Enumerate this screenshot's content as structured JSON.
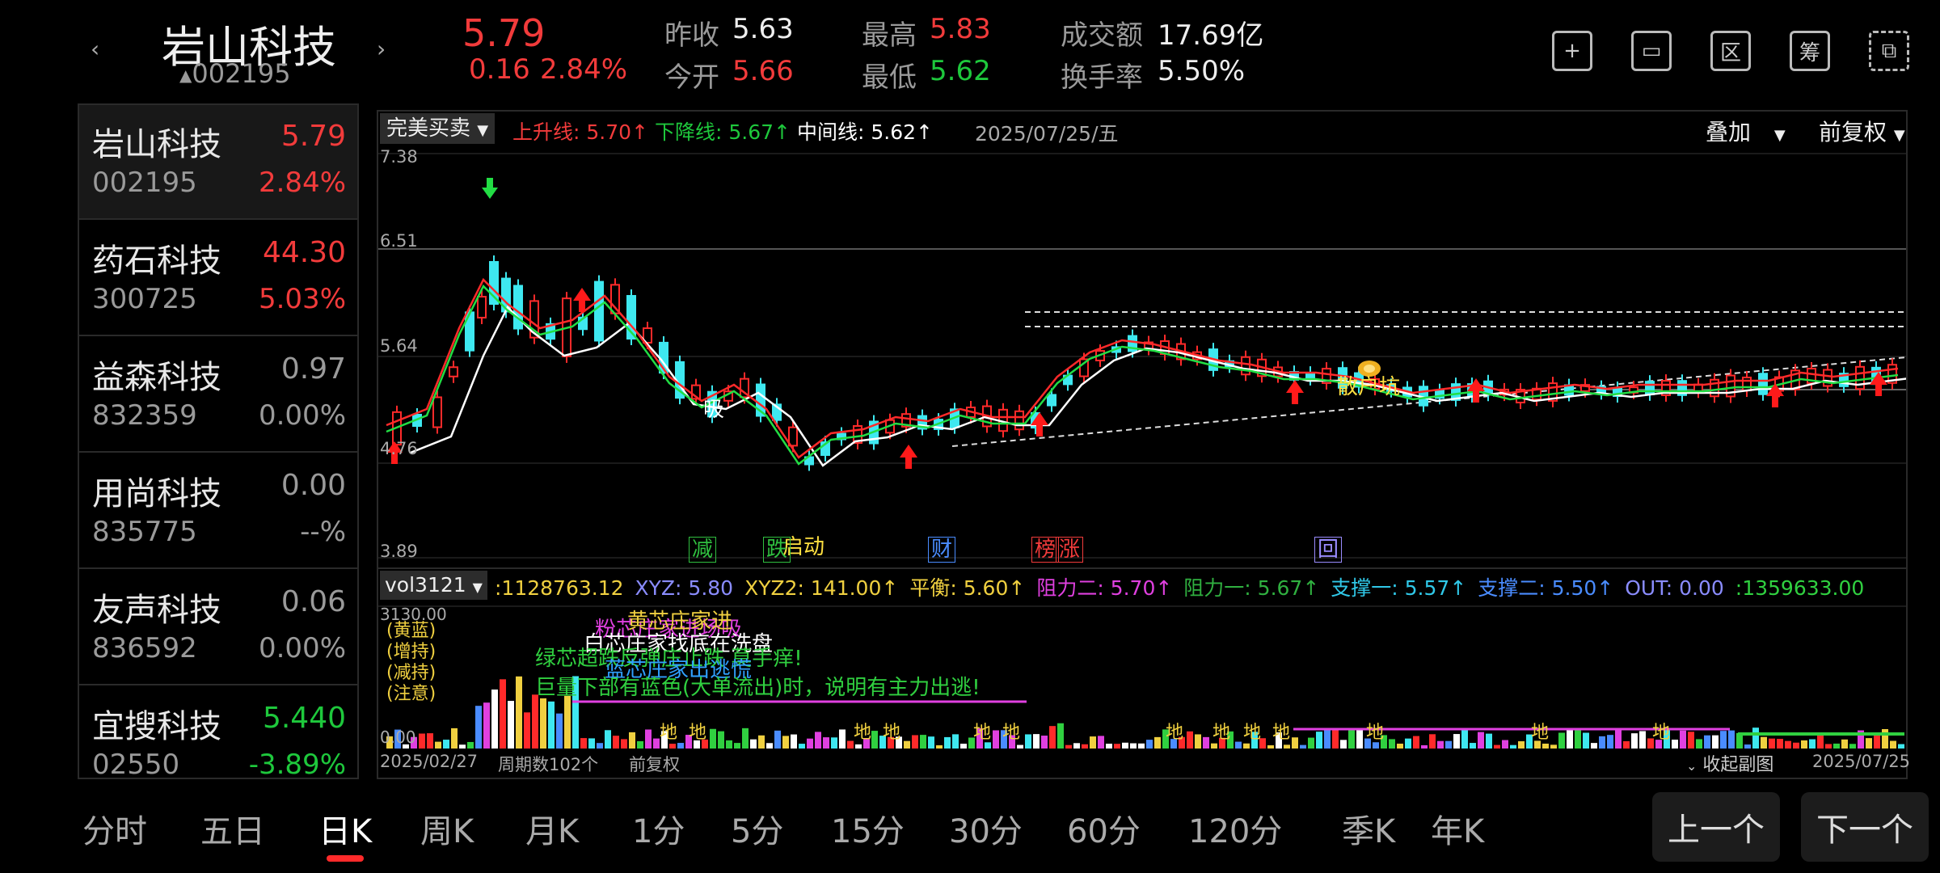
{
  "header": {
    "name": "岩山科技",
    "code": "002195",
    "price": "5.79",
    "change": "0.16",
    "change_pct": "2.84%",
    "prev_close_label": "昨收",
    "prev_close": "5.63",
    "open_label": "今开",
    "open": "5.66",
    "high_label": "最高",
    "high": "5.83",
    "low_label": "最低",
    "low": "5.62",
    "amount_label": "成交额",
    "amount": "17.69亿",
    "turnover_label": "换手率",
    "turnover": "5.50%",
    "icons": [
      "add-icon",
      "window-icon",
      "region-icon",
      "chip-icon",
      "device-switch-icon"
    ],
    "icon_glyphs": [
      "+",
      "▭",
      "区",
      "筹",
      "⧉"
    ]
  },
  "sidebar": {
    "items": [
      {
        "name": "岩山科技",
        "code": "002195",
        "price": "5.79",
        "pct": "2.84%",
        "color": "#f23b3b"
      },
      {
        "name": "药石科技",
        "code": "300725",
        "price": "44.30",
        "pct": "5.03%",
        "color": "#f23b3b"
      },
      {
        "name": "益森科技",
        "code": "832359",
        "price": "0.97",
        "pct": "0.00%",
        "color": "#9a9a9a"
      },
      {
        "name": "用尚科技",
        "code": "835775",
        "price": "0.00",
        "pct": "--%",
        "color": "#9a9a9a"
      },
      {
        "name": "友声科技",
        "code": "836592",
        "price": "0.06",
        "pct": "0.00%",
        "color": "#9a9a9a"
      },
      {
        "name": "宜搜科技",
        "code": "02550",
        "price": "5.440",
        "pct": "-3.89%",
        "color": "#1ec83c"
      }
    ]
  },
  "chart": {
    "indicator_select": "完美买卖",
    "upper_line": "上升线: 5.70↑",
    "lower_line": "下降线: 5.67↑",
    "mid_line": "中间线: 5.62↑",
    "date_label": "2025/07/25/五",
    "overlay_label": "叠加",
    "adjust_label": "前复权",
    "y_labels": [
      "7.38",
      "6.51",
      "5.64",
      "4.76",
      "3.89"
    ],
    "annotations": {
      "xi": "吸",
      "qidong": "启动",
      "sanhu": "散户坑"
    },
    "badges": [
      "减",
      "跌",
      "财",
      "榜",
      "涨",
      "回"
    ],
    "start_date": "2025/02/27",
    "period_count": "周期数102个",
    "adjust_footer": "前复权",
    "collapse_label": "收起副图",
    "end_date": "2025/07/25"
  },
  "sub_indicator": {
    "select": "vol3121",
    "values": [
      {
        "text": ":1128763.12",
        "color": "#f0d040"
      },
      {
        "text": "XYZ: 5.80",
        "color": "#8a8cff"
      },
      {
        "text": "XYZ2: 141.00↑",
        "color": "#f0d040"
      },
      {
        "text": "平衡: 5.60↑",
        "color": "#f0d040"
      },
      {
        "text": "阻力二: 5.70↑",
        "color": "#e040e0"
      },
      {
        "text": "阻力一: 5.67↑",
        "color": "#30b040"
      },
      {
        "text": "支撑一: 5.57↑",
        "color": "#30c8e8"
      },
      {
        "text": "支撑二: 5.50↑",
        "color": "#4a8cff"
      },
      {
        "text": "OUT: 0.00",
        "color": "#8a8cff"
      },
      {
        "text": ":1359633.00",
        "color": "#30d040"
      }
    ],
    "max_label": "3130.00",
    "zero_label": "0.00",
    "legend_lines": [
      {
        "text": "粉芯庄家进场吸",
        "color": "#e040e0"
      },
      {
        "text": "黄芯庄家进",
        "color": "#f0d040"
      },
      {
        "text": "白芯庄家找底在洗盘",
        "color": "#ffffff"
      },
      {
        "text": "绿芯超跌反弹庄止跌 莫手痒!",
        "color": "#30d040"
      },
      {
        "text": "蓝芯庄家出逃慌",
        "color": "#30a0ff"
      },
      {
        "text": "巨量下部有蓝色(大单流出)时，说明有主力出逃!",
        "color": "#30d040"
      }
    ],
    "side_notes": [
      "(黄蓝)",
      "(增持)",
      "(减持)",
      "(注意)"
    ],
    "di_mark": "地"
  },
  "bottom_nav": {
    "tabs": [
      "分时",
      "五日",
      "日K",
      "周K",
      "月K",
      "1分",
      "5分",
      "15分",
      "30分",
      "60分",
      "120分",
      "季K",
      "年K"
    ],
    "active": "日K",
    "prev": "上一个",
    "next": "下一个"
  }
}
